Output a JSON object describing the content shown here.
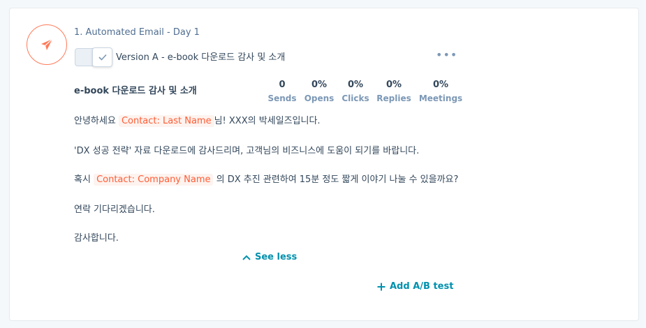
{
  "step": {
    "title": "1. Automated Email - Day 1",
    "icon": "paper-plane-icon",
    "accent": "#ff7a59"
  },
  "version": {
    "label": "Version A - e-book 다운로드 감사 및 소개",
    "toggle_icon": "check-icon",
    "more_label": "•••"
  },
  "email": {
    "subject": "e-book 다운로드 감사 및 소개",
    "stats": [
      {
        "value": "0",
        "label": "Sends"
      },
      {
        "value": "0%",
        "label": "Opens"
      },
      {
        "value": "0%",
        "label": "Clicks"
      },
      {
        "value": "0%",
        "label": "Replies"
      },
      {
        "value": "0%",
        "label": "Meetings"
      }
    ],
    "body": {
      "line1_before": "안녕하세요 ",
      "line1_token": "Contact: Last Name",
      "line1_after": "님! XXX의 박세일즈입니다.",
      "line2": "'DX 성공 전략' 자료 다운로드에 감사드리며, 고객님의 비즈니스에 도움이 되기를 바랍니다.",
      "line3_before": " 혹시 ",
      "line3_token": "Contact: Company Name",
      "line3_after": " 의 DX 추진 관련하여 15분 정도 짧게 이야기 나눌 수 있을까요?",
      "line4": "연락 기다리겠습니다.",
      "line5": "감사합니다."
    }
  },
  "actions": {
    "see_less": "See less",
    "add_ab_test": "Add A/B test"
  },
  "colors": {
    "link": "#0091ae",
    "token_text": "#ff5c35",
    "token_bg": "#fdf3ef"
  }
}
